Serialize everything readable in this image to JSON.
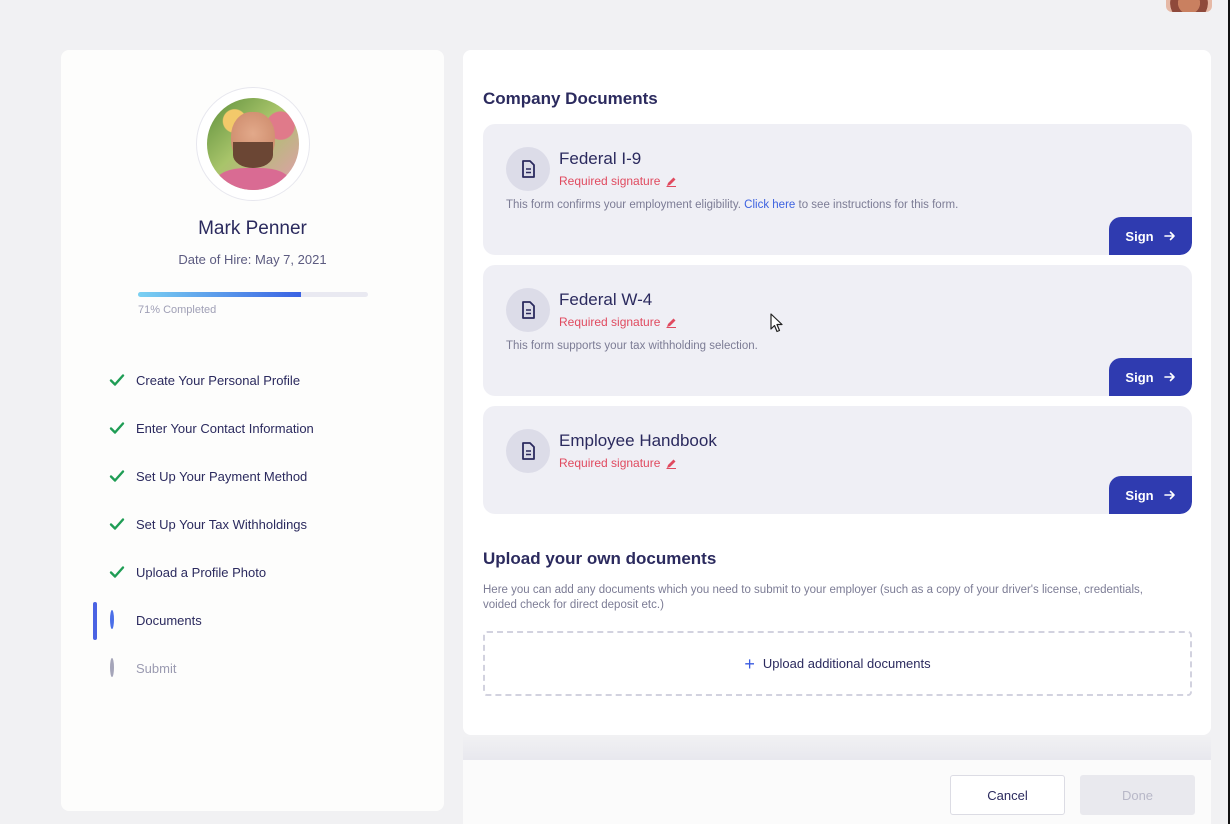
{
  "profile": {
    "name": "Mark Penner",
    "hire_date": "Date of Hire: May 7, 2021",
    "progress_percent": 71,
    "progress_label": "71% Completed"
  },
  "steps": [
    {
      "label": "Create Your Personal Profile",
      "status": "done"
    },
    {
      "label": "Enter Your Contact Information",
      "status": "done"
    },
    {
      "label": "Set Up Your Payment Method",
      "status": "done"
    },
    {
      "label": "Set Up Your Tax Withholdings",
      "status": "done"
    },
    {
      "label": "Upload a Profile Photo",
      "status": "done"
    },
    {
      "label": "Documents",
      "status": "active"
    },
    {
      "label": "Submit",
      "status": "pending"
    }
  ],
  "company_documents": {
    "title": "Company Documents",
    "items": [
      {
        "title": "Federal I-9",
        "required": "Required signature",
        "desc_before": "This form confirms your employment eligibility.",
        "desc_link": "Click here",
        "desc_after": "to see instructions for this form.",
        "sign_label": "Sign"
      },
      {
        "title": "Federal W-4",
        "required": "Required signature",
        "desc_before": "This form supports your tax withholding selection.",
        "sign_label": "Sign"
      },
      {
        "title": "Employee Handbook",
        "required": "Required signature",
        "sign_label": "Sign"
      }
    ]
  },
  "upload": {
    "title": "Upload your own documents",
    "description": "Here you can add any documents which you need to submit to your employer (such as a copy of your driver's license, credentials, voided check for direct deposit etc.)",
    "button_label": "Upload additional documents"
  },
  "footer": {
    "cancel_label": "Cancel",
    "done_label": "Done"
  },
  "colors": {
    "accent": "#2f3bb0",
    "check": "#1f9d55",
    "required": "#e04a5f",
    "link": "#3d62e0"
  },
  "icons": [
    "document-icon",
    "pencil-icon",
    "arrow-right-icon",
    "check-icon",
    "plus-icon",
    "cursor-icon"
  ]
}
